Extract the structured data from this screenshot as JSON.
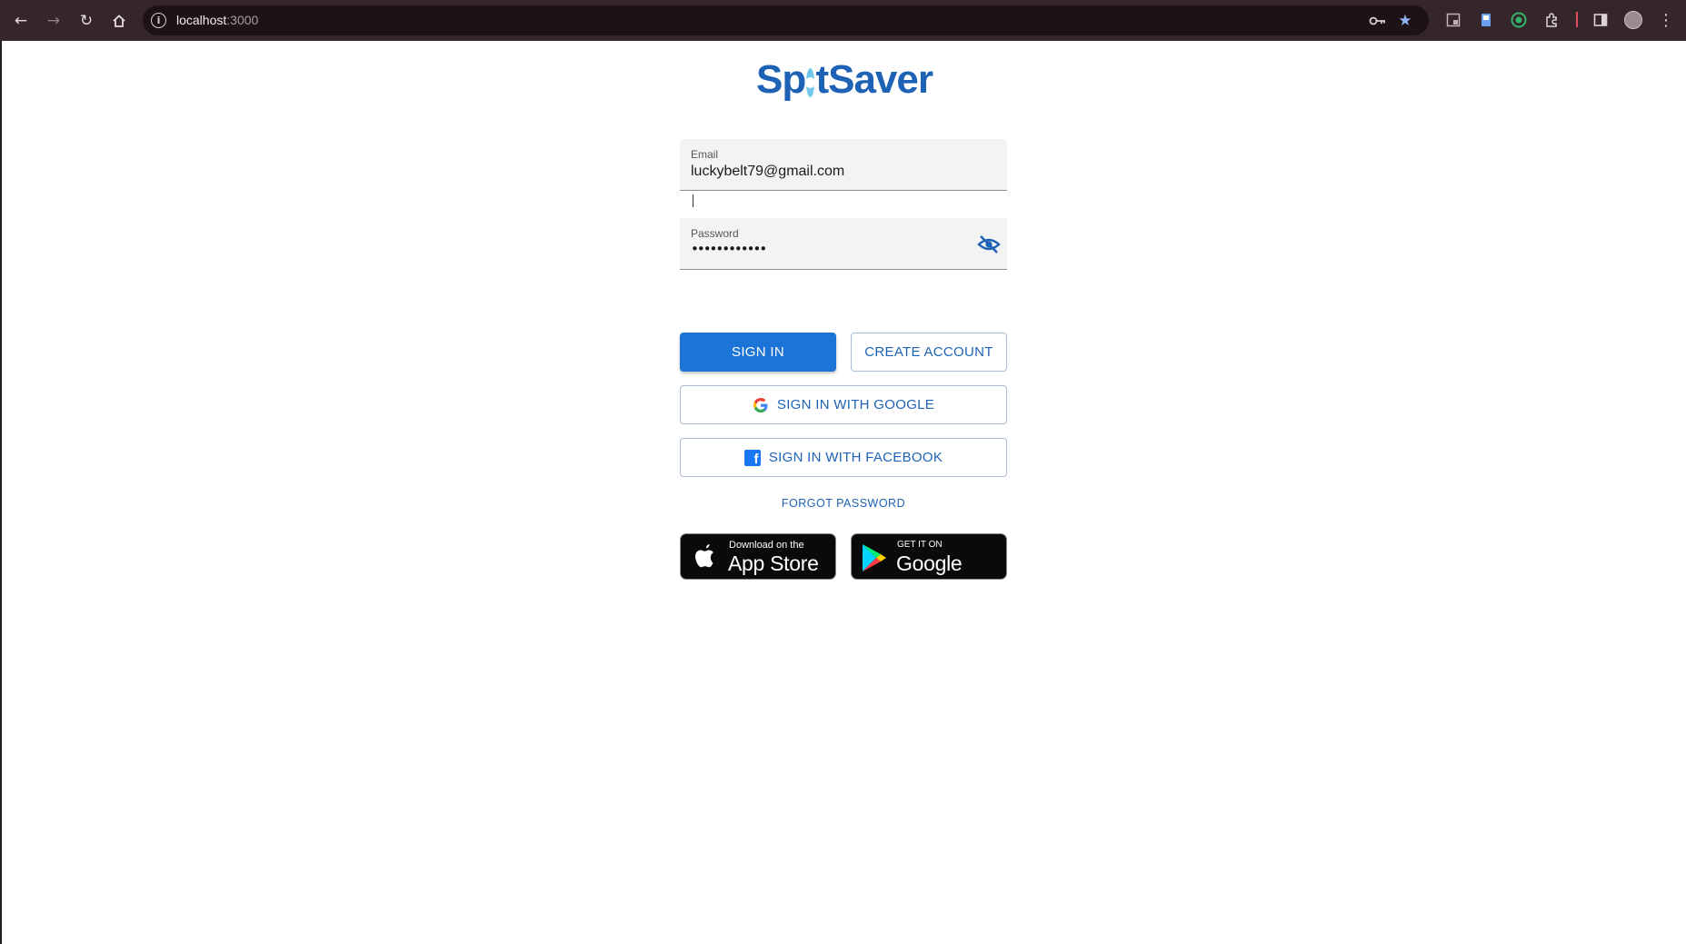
{
  "browser": {
    "url_host": "localhost",
    "url_port": ":3000"
  },
  "app": {
    "logo_text": "Spot Saver",
    "logo_part1": "Sp",
    "logo_part2": "tSaver"
  },
  "login_form": {
    "email_label": "Email",
    "email_value": "luckybelt79@gmail.com",
    "password_label": "Password",
    "password_value": "••••••••••••",
    "sign_in_label": "SIGN IN",
    "create_account_label": "CREATE ACCOUNT",
    "google_label": "SIGN IN WITH GOOGLE",
    "facebook_label": "SIGN IN WITH FACEBOOK",
    "forgot_password_label": "FORGOT PASSWORD"
  },
  "stores": {
    "apple_small": "Download on the",
    "apple_big": "App Store",
    "google_small": "GET IT ON",
    "google_big": "Google Play"
  },
  "colors": {
    "brand_blue": "#1d62b5",
    "primary_button": "#1c74d6",
    "browser_bar": "#35262b"
  }
}
